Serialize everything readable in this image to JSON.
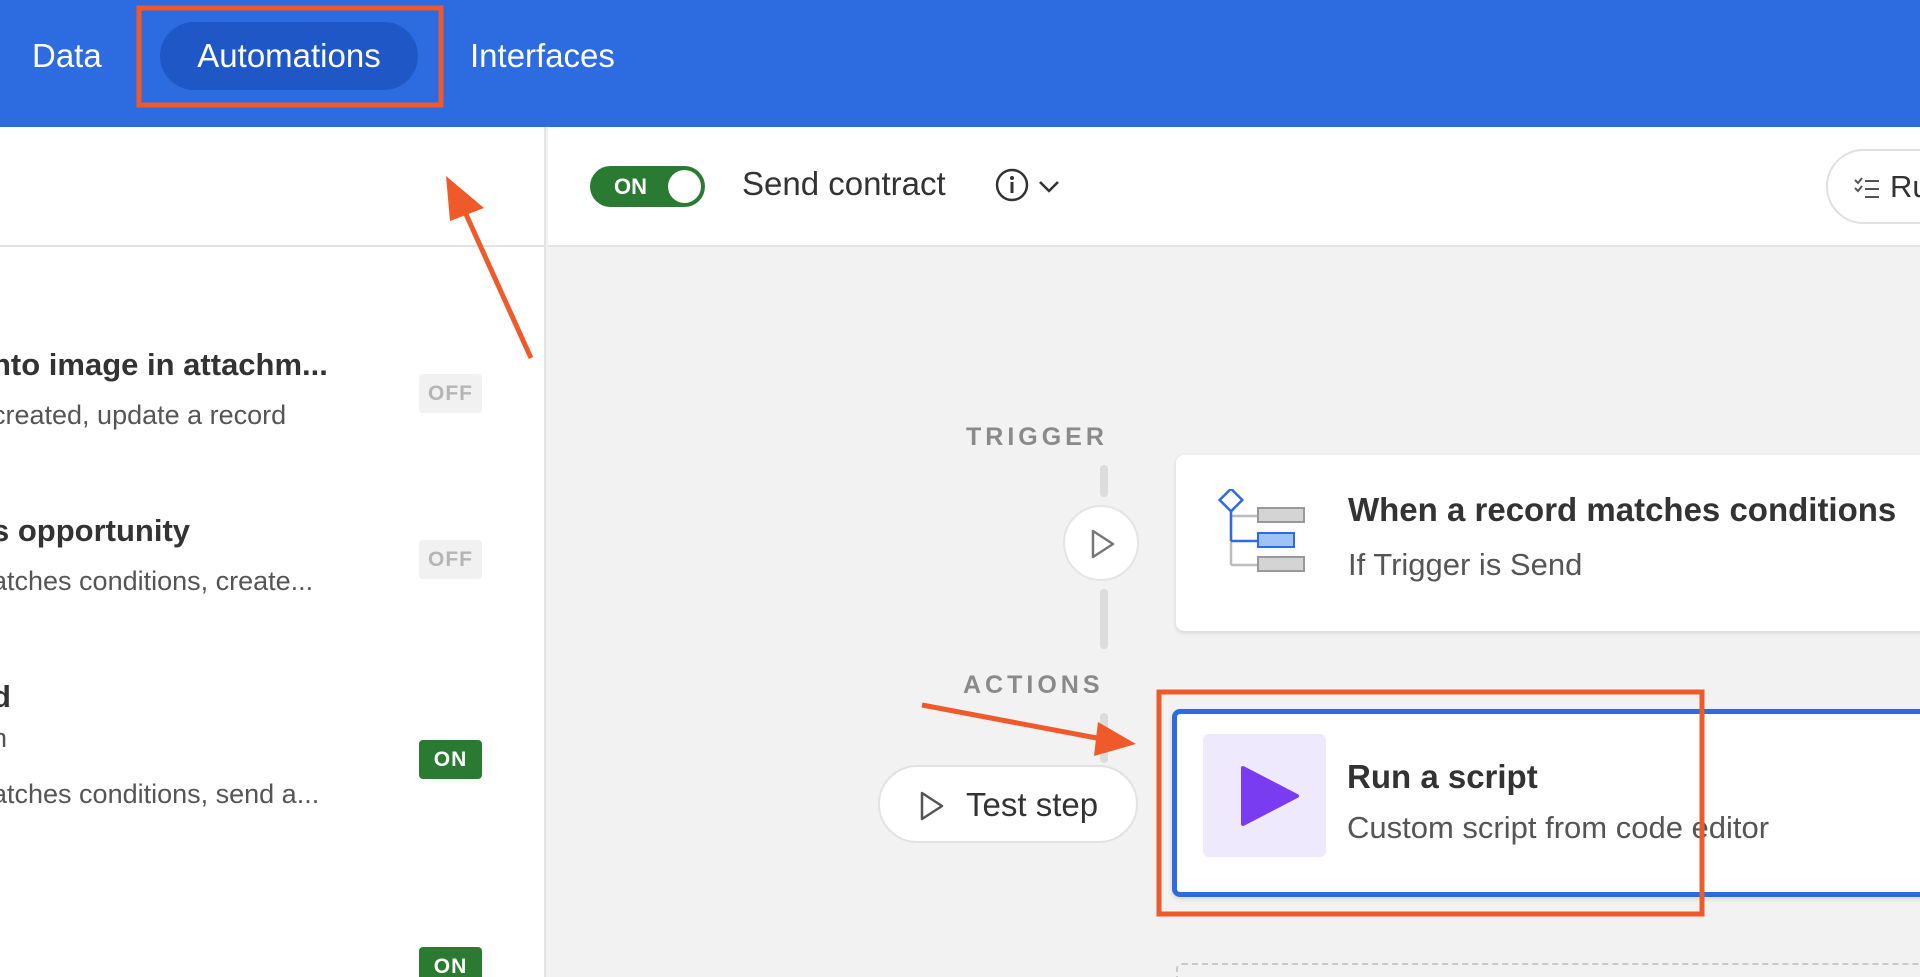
{
  "topbar": {
    "tabs": [
      {
        "label": "Data"
      },
      {
        "label": "Automations"
      },
      {
        "label": "Interfaces"
      }
    ]
  },
  "sidebar": {
    "automations": [
      {
        "title": "nto image in attachm...",
        "subtitle": "created, update a record",
        "status": "OFF"
      },
      {
        "title": "s opportunity",
        "subtitle": "atches conditions, create...",
        "status": "OFF"
      },
      {
        "title": "d",
        "subtitle": "n",
        "subtitle2": "atches conditions, send a...",
        "status": "ON"
      },
      {
        "title": "",
        "subtitle": "",
        "status": "ON"
      }
    ]
  },
  "header": {
    "toggle_label": "ON",
    "automation_name": "Send contract",
    "run_history_label": "Ru"
  },
  "canvas": {
    "trigger_label": "TRIGGER",
    "actions_label": "ACTIONS",
    "trigger_card": {
      "title": "When a record matches conditions",
      "subtitle": "If Trigger is Send"
    },
    "action_card": {
      "title": "Run a script",
      "subtitle": "Custom script from code editor"
    },
    "test_step_label": "Test step"
  },
  "colors": {
    "topbar": "#2d6be0",
    "active_tab": "#1f57c7",
    "on_green": "#2a7a32",
    "annotation": "#f05a2a",
    "selected_border": "#2d6be0",
    "script_icon": "#7a3cf0"
  }
}
